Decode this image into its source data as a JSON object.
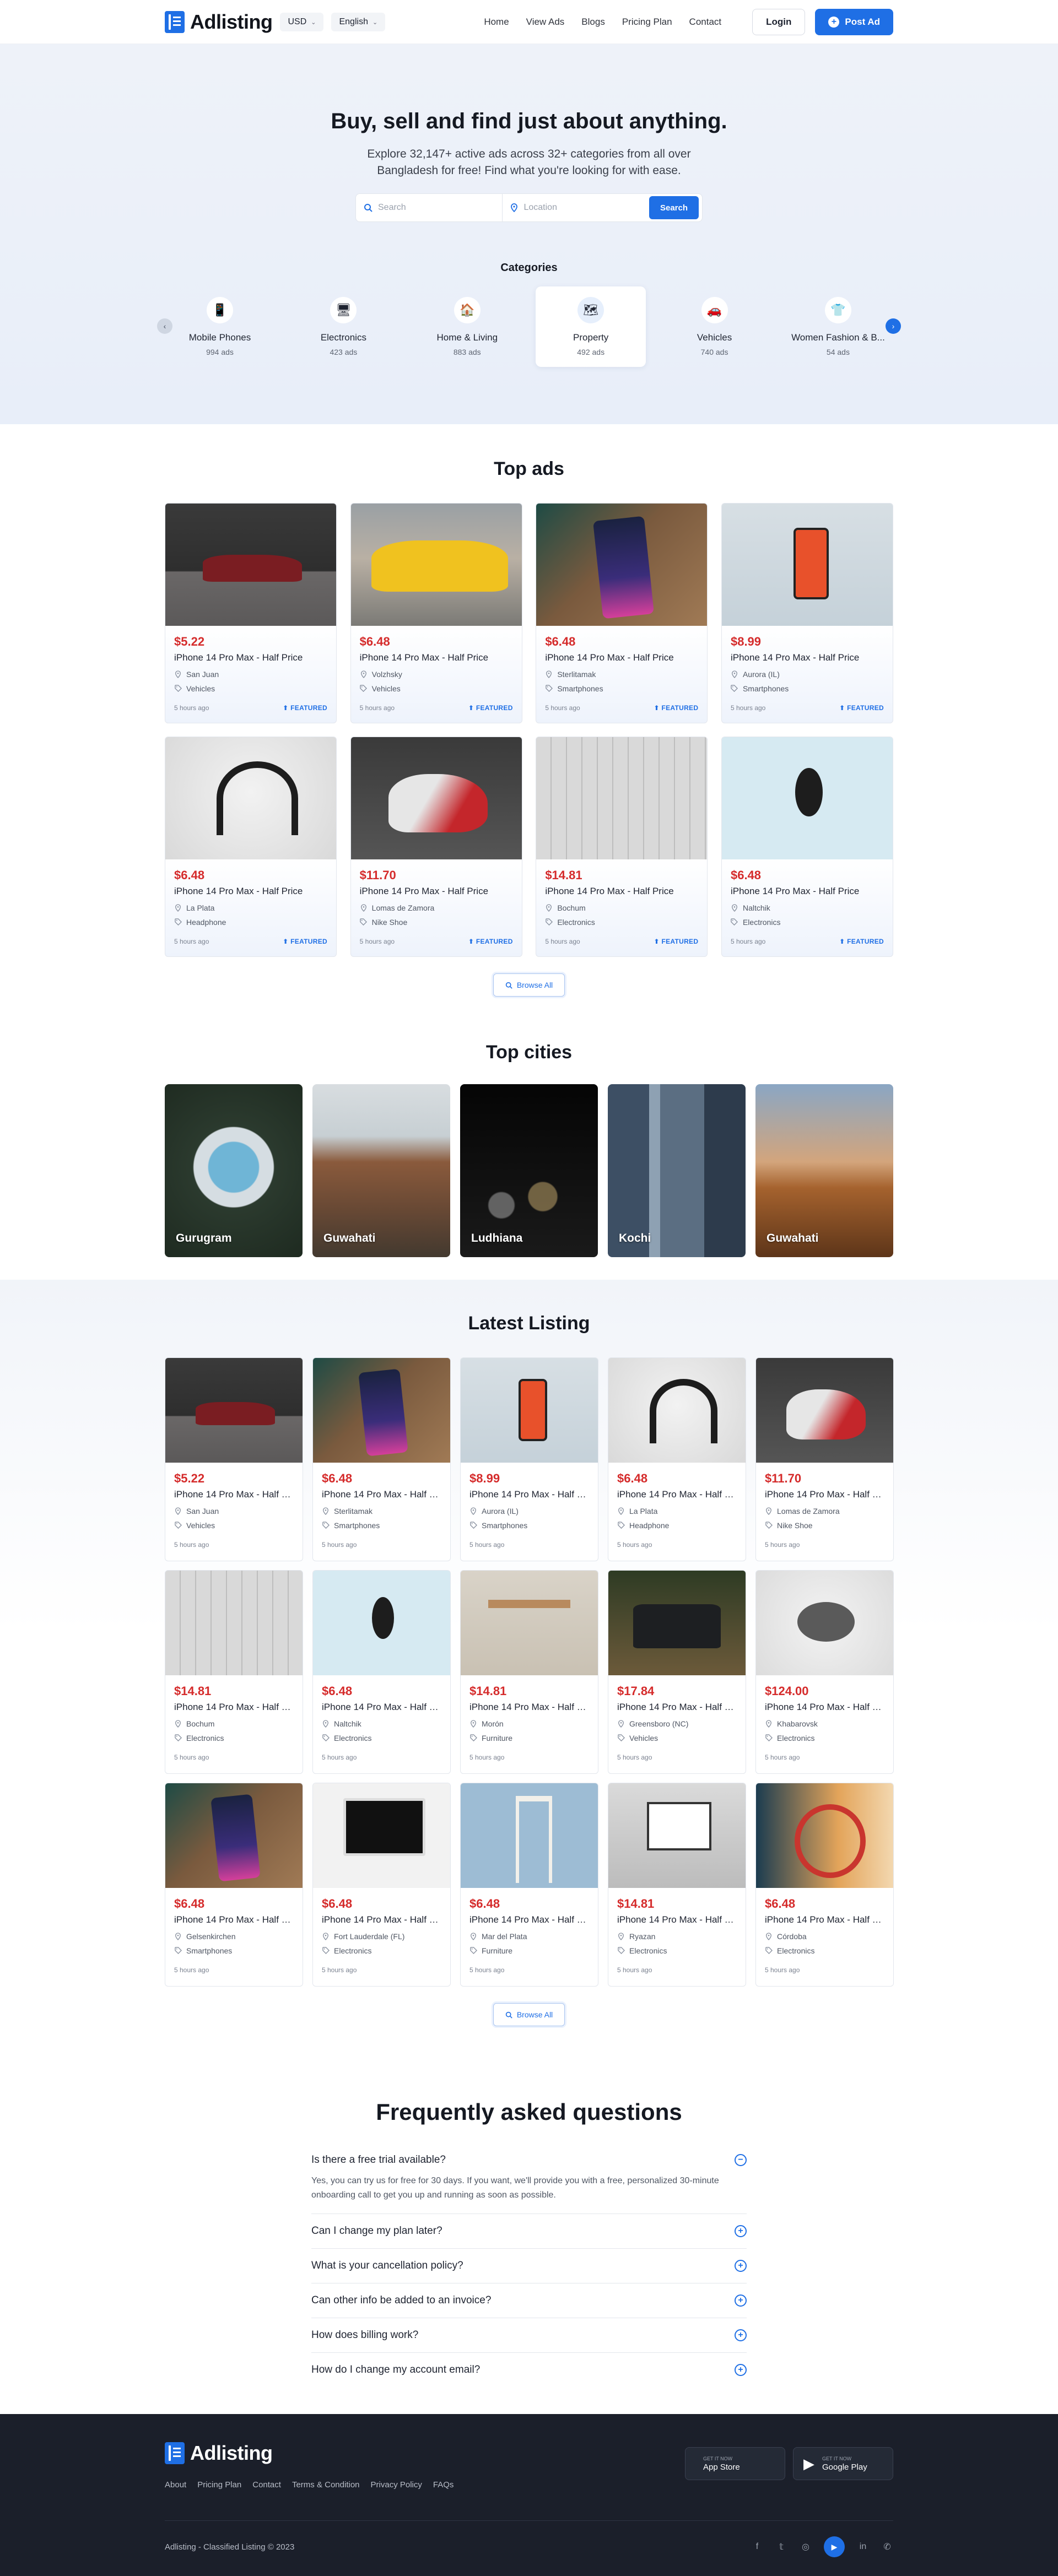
{
  "header": {
    "brand": "Adlisting",
    "currency": "USD",
    "language": "English",
    "nav": [
      "Home",
      "View Ads",
      "Blogs",
      "Pricing Plan",
      "Contact"
    ],
    "login": "Login",
    "post_ad": "Post Ad"
  },
  "hero": {
    "title": "Buy, sell and find just about anything.",
    "subtitle": "Explore 32,147+ active ads across 32+ categories from all over Bangladesh for free! Find what you're looking for with ease.",
    "search_placeholder": "Search",
    "location_placeholder": "Location",
    "search_button": "Search",
    "categories_title": "Categories",
    "categories": [
      {
        "name": "Mobile Phones",
        "count": "994 ads",
        "icon": "phone-icon",
        "glyph": "📱"
      },
      {
        "name": "Electronics",
        "count": "423 ads",
        "icon": "electronics-icon",
        "glyph": "🖥"
      },
      {
        "name": "Home & Living",
        "count": "883 ads",
        "icon": "home-icon",
        "glyph": "🏠"
      },
      {
        "name": "Property",
        "count": "492 ads",
        "icon": "property-icon",
        "glyph": "🗺"
      },
      {
        "name": "Vehicles",
        "count": "740 ads",
        "icon": "car-icon",
        "glyph": "🚗"
      },
      {
        "name": "Women Fashion & B...",
        "count": "54 ads",
        "icon": "shirt-icon",
        "glyph": "👕"
      }
    ]
  },
  "top_ads": {
    "title": "Top ads",
    "browse": "Browse All",
    "items": [
      {
        "price": "$5.22",
        "title": "iPhone 14 Pro Max - Half Price",
        "location": "San Juan",
        "category": "Vehicles",
        "time": "5 hours ago",
        "badge": "FEATURED",
        "img": "i-car-red"
      },
      {
        "price": "$6.48",
        "title": "iPhone 14 Pro Max - Half Price",
        "location": "Volzhsky",
        "category": "Vehicles",
        "time": "5 hours ago",
        "badge": "FEATURED",
        "img": "i-taxi"
      },
      {
        "price": "$6.48",
        "title": "iPhone 14 Pro Max - Half Price",
        "location": "Sterlitamak",
        "category": "Smartphones",
        "time": "5 hours ago",
        "badge": "FEATURED",
        "img": "i-phone-wood"
      },
      {
        "price": "$8.99",
        "title": "iPhone 14 Pro Max - Half Price",
        "location": "Aurora (IL)",
        "category": "Smartphones",
        "time": "5 hours ago",
        "badge": "FEATURED",
        "img": "i-phone-hand"
      },
      {
        "price": "$6.48",
        "title": "iPhone 14 Pro Max - Half Price",
        "location": "La Plata",
        "category": "Headphone",
        "time": "5 hours ago",
        "badge": "FEATURED",
        "img": "i-headphone"
      },
      {
        "price": "$11.70",
        "title": "iPhone 14 Pro Max - Half Price",
        "location": "Lomas de Zamora",
        "category": "Nike Shoe",
        "time": "5 hours ago",
        "badge": "FEATURED",
        "img": "i-shoe"
      },
      {
        "price": "$14.81",
        "title": "iPhone 14 Pro Max - Half Price",
        "location": "Bochum",
        "category": "Electronics",
        "time": "5 hours ago",
        "badge": "FEATURED",
        "img": "i-keyboard"
      },
      {
        "price": "$6.48",
        "title": "iPhone 14 Pro Max - Half Price",
        "location": "Naltchik",
        "category": "Electronics",
        "time": "5 hours ago",
        "badge": "FEATURED",
        "img": "i-mouse-blue"
      }
    ]
  },
  "top_cities": {
    "title": "Top cities",
    "items": [
      {
        "name": "Gurugram",
        "img": "c-guru"
      },
      {
        "name": "Guwahati",
        "img": "c-guwa1"
      },
      {
        "name": "Ludhiana",
        "img": "c-ludh"
      },
      {
        "name": "Kochi",
        "img": "c-kochi"
      },
      {
        "name": "Guwahati",
        "img": "c-guwa2"
      }
    ]
  },
  "latest": {
    "title": "Latest Listing",
    "browse": "Browse All",
    "items": [
      {
        "price": "$5.22",
        "title": "iPhone 14 Pro Max - Half P...",
        "location": "San Juan",
        "category": "Vehicles",
        "time": "5 hours ago",
        "img": "i-car-red"
      },
      {
        "price": "$6.48",
        "title": "iPhone 14 Pro Max - Half P...",
        "location": "Sterlitamak",
        "category": "Smartphones",
        "time": "5 hours ago",
        "img": "i-phone-wood"
      },
      {
        "price": "$8.99",
        "title": "iPhone 14 Pro Max - Half P...",
        "location": "Aurora (IL)",
        "category": "Smartphones",
        "time": "5 hours ago",
        "img": "i-phone-hand"
      },
      {
        "price": "$6.48",
        "title": "iPhone 14 Pro Max - Half P...",
        "location": "La Plata",
        "category": "Headphone",
        "time": "5 hours ago",
        "img": "i-headphone"
      },
      {
        "price": "$11.70",
        "title": "iPhone 14 Pro Max - Half P...",
        "location": "Lomas de Zamora",
        "category": "Nike Shoe",
        "time": "5 hours ago",
        "img": "i-shoe"
      },
      {
        "price": "$14.81",
        "title": "iPhone 14 Pro Max - Half P...",
        "location": "Bochum",
        "category": "Electronics",
        "time": "5 hours ago",
        "img": "i-keyboard"
      },
      {
        "price": "$6.48",
        "title": "iPhone 14 Pro Max - Half P...",
        "location": "Naltchik",
        "category": "Electronics",
        "time": "5 hours ago",
        "img": "i-mouse-blue"
      },
      {
        "price": "$14.81",
        "title": "iPhone 14 Pro Max - Half P...",
        "location": "Morón",
        "category": "Furniture",
        "time": "5 hours ago",
        "img": "i-table"
      },
      {
        "price": "$17.84",
        "title": "iPhone 14 Pro Max - Half P...",
        "location": "Greensboro (NC)",
        "category": "Vehicles",
        "time": "5 hours ago",
        "img": "i-suv"
      },
      {
        "price": "$124.00",
        "title": "iPhone 14 Pro Max - Half P...",
        "location": "Khabarovsk",
        "category": "Electronics",
        "time": "5 hours ago",
        "img": "i-mouse-white"
      },
      {
        "price": "$6.48",
        "title": "iPhone 14 Pro Max - Half P...",
        "location": "Gelsenkirchen",
        "category": "Smartphones",
        "time": "5 hours ago",
        "img": "i-phone-wood"
      },
      {
        "price": "$6.48",
        "title": "iPhone 14 Pro Max - Half P...",
        "location": "Fort Lauderdale (FL)",
        "category": "Electronics",
        "time": "5 hours ago",
        "img": "i-imac"
      },
      {
        "price": "$6.48",
        "title": "iPhone 14 Pro Max - Half P...",
        "location": "Mar del Plata",
        "category": "Furniture",
        "time": "5 hours ago",
        "img": "i-stool"
      },
      {
        "price": "$14.81",
        "title": "iPhone 14 Pro Max - Half P...",
        "location": "Ryazan",
        "category": "Electronics",
        "time": "5 hours ago",
        "img": "i-laptop"
      },
      {
        "price": "$6.48",
        "title": "iPhone 14 Pro Max - Half P...",
        "location": "Córdoba",
        "category": "Electronics",
        "time": "5 hours ago",
        "img": "i-headphone2"
      }
    ]
  },
  "faq": {
    "title": "Frequently asked questions",
    "items": [
      {
        "q": "Is there a free trial available?",
        "a": "Yes, you can try us for free for 30 days. If you want, we'll provide you with a free, personalized 30-minute onboarding call to get you up and running as soon as possible.",
        "open": true
      },
      {
        "q": "Can I change my plan later?",
        "a": "",
        "open": false
      },
      {
        "q": "What is your cancellation policy?",
        "a": "",
        "open": false
      },
      {
        "q": "Can other info be added to an invoice?",
        "a": "",
        "open": false
      },
      {
        "q": "How does billing work?",
        "a": "",
        "open": false
      },
      {
        "q": "How do I change my account email?",
        "a": "",
        "open": false
      }
    ]
  },
  "footer": {
    "brand": "Adlisting",
    "links": [
      "About",
      "Pricing Plan",
      "Contact",
      "Terms & Condition",
      "Privacy Policy",
      "FAQs"
    ],
    "app_store": {
      "small": "GET IT NOW",
      "label": "App Store"
    },
    "google_play": {
      "small": "GET IT NOW",
      "label": "Google Play"
    },
    "copyright": "Adlisting - Classified Listing © 2023",
    "social": [
      "facebook-icon",
      "twitter-icon",
      "instagram-icon",
      "youtube-icon",
      "linkedin-icon",
      "whatsapp-icon"
    ]
  },
  "colors": {
    "accent": "#1f6fe5",
    "price": "#d52b2b",
    "footer_bg": "#1b1f2a"
  }
}
